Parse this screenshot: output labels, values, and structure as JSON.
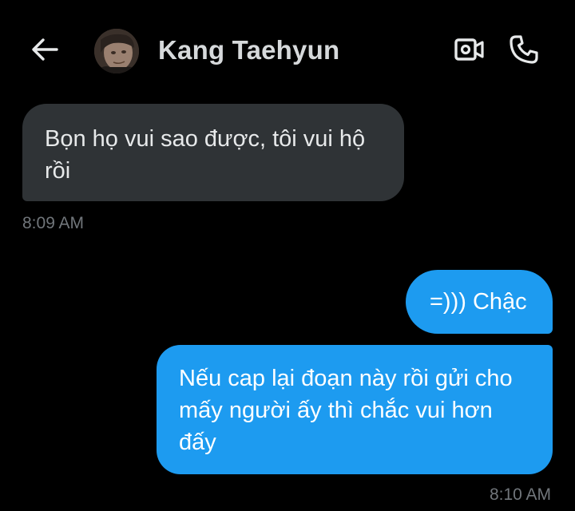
{
  "header": {
    "contact_name": "Kang Taehyun",
    "icons": {
      "back": "arrow-left-icon",
      "video": "video-camera-icon",
      "call": "phone-icon"
    }
  },
  "messages": [
    {
      "direction": "incoming",
      "lines": [
        "Bọn họ vui sao được, tôi vui hộ",
        "rồi"
      ],
      "time": "8:09 AM"
    },
    {
      "direction": "outgoing",
      "lines": [
        "=))) Chậc"
      ]
    },
    {
      "direction": "outgoing",
      "lines": [
        "Nếu cap lại đoạn này rồi gửi cho",
        "mấy người ấy thì chắc vui hơn",
        "đấy"
      ],
      "time": "8:10 AM"
    }
  ],
  "colors": {
    "background": "#000000",
    "incoming_bubble": "#2f3336",
    "outgoing_bubble": "#1d9bf0",
    "timestamp": "#71767b"
  }
}
